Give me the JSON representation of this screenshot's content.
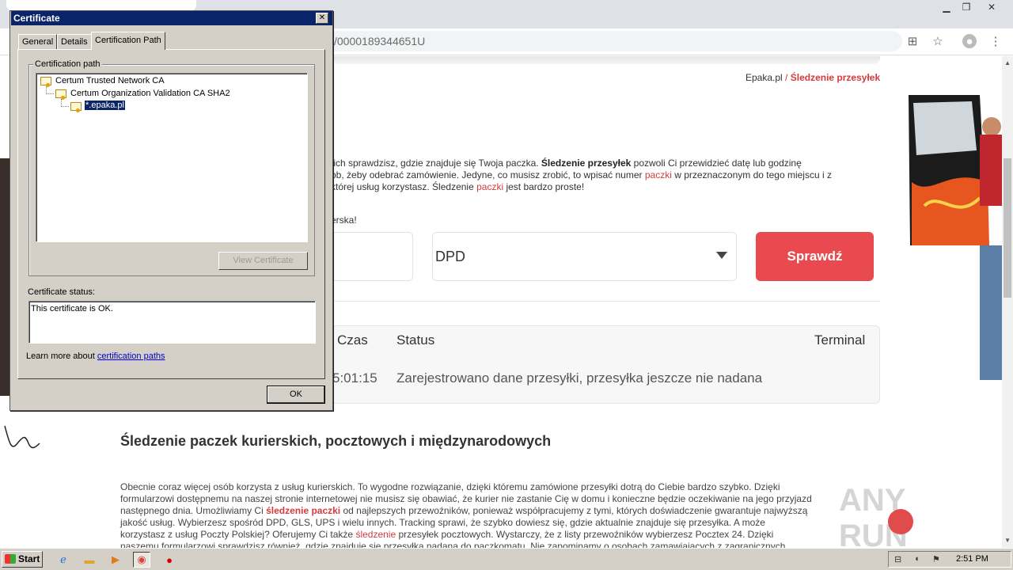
{
  "browser": {
    "url_fragment": "/0000189344651U"
  },
  "page": {
    "breadcrumb": {
      "home": "Epaka.pl",
      "separator": "/",
      "current": "Śledzenie przesyłek"
    },
    "intro": {
      "line1_a": "tich sprawdzisz, gdzie znajduje się Twoja paczka. ",
      "line1_b": "Śledzenie przesyłek",
      "line1_c": " pozwoli Ci przewidzieć datę lub godzinę",
      "line2_a": "ob, żeby odebrać zamówienie. Jedyne, co musisz zrobić, to wpisać numer ",
      "line2_b": "paczki",
      "line2_c": " w przeznaczonym do tego miejscu i z",
      "line3_a": "której usług korzystasz. Śledzenie ",
      "line3_b": "paczki",
      "line3_c": " jest bardzo proste!",
      "line4": "erska!"
    },
    "form": {
      "carrier_value": "DPD",
      "check_label": "Sprawdź"
    },
    "results": {
      "headers": {
        "time": "Czas",
        "status": "Status",
        "terminal": "Terminal"
      },
      "row": {
        "time": "5:01:15",
        "status": "Zarejestrowano dane przesyłki, przesyłka jeszcze nie nadana",
        "terminal": ""
      }
    },
    "section": {
      "title": "Śledzenie paczek kurierskich, pocztowych i międzynarodowych",
      "p1": "Obecnie coraz więcej osób korzysta z usług kurierskich. To wygodne rozwiązanie, dzięki któremu zamówione przesyłki dotrą do Ciebie bardzo szybko. Dzięki",
      "p2": "formularzowi dostępnemu na naszej stronie internetowej nie musisz się obawiać, że kurier nie zastanie Cię w domu i konieczne będzie oczekiwanie na jego przyjazd",
      "p3_a": "następnego dnia. Umożliwiamy Ci ",
      "p3_b": "śledzenie paczki",
      "p3_c": " od najlepszych przewoźników, ponieważ współpracujemy z tymi, których doświadczenie gwarantuje najwyższą",
      "p4": "jakość usług. Wybierzesz spośród DPD, GLS, UPS i wielu innych. Tracking sprawi, że szybko dowiesz się, gdzie aktualnie znajduje się przesyłka. A może",
      "p5_a": "korzystasz z usług Poczty Polskiej? Oferujemy Ci także ",
      "p5_b": "śledzenie",
      "p5_c": " przesyłek pocztowych. Wystarczy, że z listy przewoźników wybierzesz Pocztex 24. Dzięki",
      "p6": "naszemu formularzowi sprawdzisz również, gdzie znajduje się przesyłka nadana do paczkomatu. Nie zapominamy o osobach zamawiających z zagranicznych"
    },
    "watermark": "ANY RUN"
  },
  "dialog": {
    "title": "Certificate",
    "close": "✕",
    "tabs": [
      "General",
      "Details",
      "Certification Path"
    ],
    "group_label": "Certification path",
    "tree": [
      "Certum Trusted Network CA",
      "Certum Organization Validation CA SHA2",
      "*.epaka.pl"
    ],
    "view_certificate": "View Certificate",
    "status_label": "Certificate status:",
    "status_text": "This certificate is OK.",
    "learn_prefix": "Learn more about ",
    "learn_link": "certification paths",
    "ok": "OK"
  },
  "taskbar": {
    "start": "Start",
    "clock": "2:51 PM"
  }
}
